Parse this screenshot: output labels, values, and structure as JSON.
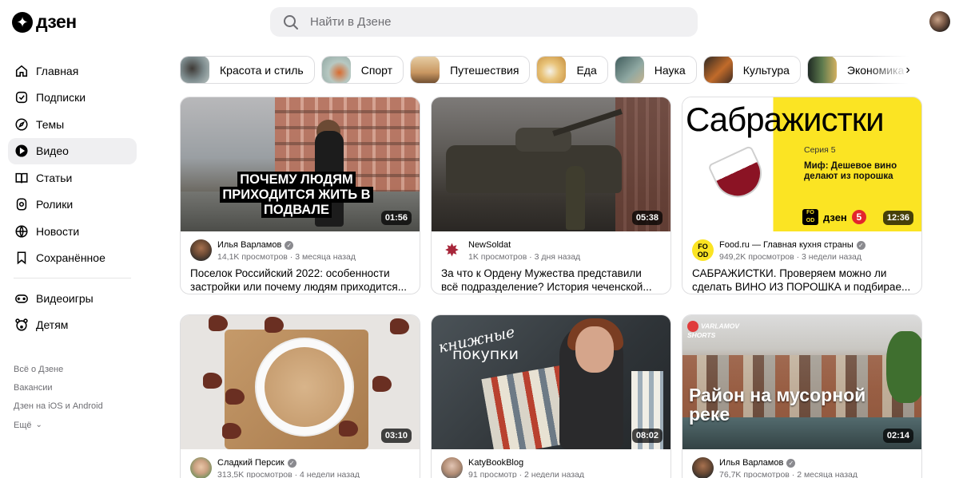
{
  "header": {
    "logo_text": "дзен",
    "search_placeholder": "Найти в Дзене"
  },
  "sidebar": {
    "items": [
      {
        "label": "Главная",
        "icon": "home-icon"
      },
      {
        "label": "Подписки",
        "icon": "subscriptions-icon"
      },
      {
        "label": "Темы",
        "icon": "compass-icon"
      },
      {
        "label": "Видео",
        "icon": "video-icon",
        "active": true
      },
      {
        "label": "Статьи",
        "icon": "book-icon"
      },
      {
        "label": "Ролики",
        "icon": "shorts-icon"
      },
      {
        "label": "Новости",
        "icon": "news-icon"
      },
      {
        "label": "Сохранённое",
        "icon": "bookmark-icon"
      }
    ],
    "extra_items": [
      {
        "label": "Видеоигры",
        "icon": "gamepad-icon"
      },
      {
        "label": "Детям",
        "icon": "bear-icon"
      }
    ],
    "footer_links": [
      "Всё о Дзене",
      "Вакансии",
      "Дзен на iOS и Android",
      "Ещё"
    ]
  },
  "topics": [
    "Красота и стиль",
    "Спорт",
    "Путешествия",
    "Еда",
    "Наука",
    "Культура",
    "Экономика"
  ],
  "colors": {
    "accent_bg": "#efeff1",
    "secondary_text": "#6e6e73",
    "brand_yellow": "#fbe423"
  },
  "cards": [
    {
      "channel": "Илья Варламов",
      "verified": true,
      "stats": "14,1K просмотров · 3 месяца назад",
      "title": "Поселок Российский 2022: особенности застройки или почему людям приходится...",
      "duration": "01:56",
      "thumb_caption": "ПОЧЕМУ ЛЮДЯМ ПРИХОДИТСЯ ЖИТЬ В ПОДВАЛЕ"
    },
    {
      "channel": "NewSoldat",
      "verified": false,
      "stats": "1K просмотров · 3 дня назад",
      "title": "За что к Ордену Мужества представили всё подразделение? История чеченской...",
      "duration": "05:38"
    },
    {
      "channel": "Food.ru — Главная кухня страны",
      "verified": true,
      "stats": "949,2K просмотров · 3 недели назад",
      "title": "САБРАЖИСТКИ. Проверяем можно ли сделать ВИНО ИЗ ПОРОШКА и подбирае...",
      "duration": "12:36",
      "thumb_title": "Сабражистки",
      "thumb_series": "Серия 5",
      "thumb_myth": "Миф: Дешевое вино делают из порошка",
      "thumb_logo_food": "FO OD",
      "thumb_logo_dzen": "дзен",
      "thumb_logo_five": "5",
      "avatar_text": "FO OD"
    },
    {
      "channel": "Сладкий Персик",
      "verified": true,
      "stats": "313,5K просмотров · 4 недели назад",
      "title": "",
      "duration": "03:10"
    },
    {
      "channel": "KatyBookBlog",
      "verified": false,
      "stats": "91 просмотр · 2 недели назад",
      "title": "",
      "duration": "08:02",
      "thumb_caption_1": "книжные",
      "thumb_caption_2": "покупки"
    },
    {
      "channel": "Илья Варламов",
      "verified": true,
      "stats": "76,7K просмотров · 2 месяца назад",
      "title": "",
      "duration": "02:14",
      "thumb_tag": "VARLAMOV SHORTS",
      "thumb_caption": "Район на мусорной реке"
    }
  ]
}
